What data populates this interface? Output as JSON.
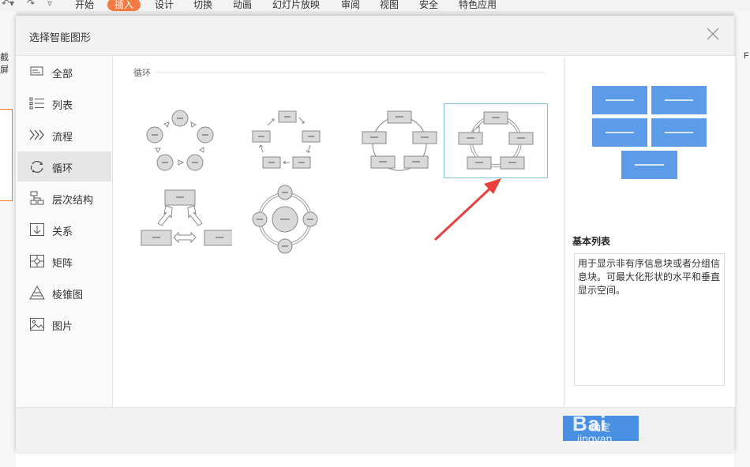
{
  "app": {
    "ribbon_tabs": [
      "开始",
      "插入",
      "设计",
      "切换",
      "动画",
      "幻灯片放映",
      "审阅",
      "视图",
      "安全",
      "特色应用"
    ],
    "active_tab": "插入",
    "left_label": "截屏",
    "right_label": "F"
  },
  "dialog": {
    "title": "选择智能图形",
    "sidebar": [
      {
        "label": "全部",
        "icon": "all-icon"
      },
      {
        "label": "列表",
        "icon": "list-icon"
      },
      {
        "label": "流程",
        "icon": "process-icon"
      },
      {
        "label": "循环",
        "icon": "cycle-icon",
        "active": true
      },
      {
        "label": "层次结构",
        "icon": "hierarchy-icon"
      },
      {
        "label": "关系",
        "icon": "relationship-icon"
      },
      {
        "label": "矩阵",
        "icon": "matrix-icon"
      },
      {
        "label": "棱锥图",
        "icon": "pyramid-icon"
      },
      {
        "label": "图片",
        "icon": "picture-icon"
      }
    ],
    "section_label": "循环",
    "options": [
      {
        "name": "basic-cycle"
      },
      {
        "name": "text-cycle"
      },
      {
        "name": "block-cycle"
      },
      {
        "name": "continuous-cycle",
        "selected": true
      },
      {
        "name": "counterbalance-arrows"
      },
      {
        "name": "radial-cycle"
      }
    ],
    "preview": {
      "name": "基本列表",
      "description": "用于显示非有序信息块或者分组信息块。可最大化形状的水平和垂直显示空间。",
      "accent": "#5b9be8"
    },
    "ok_label": "确定",
    "watermark_top": "Bai",
    "watermark_bottom": "jingyan"
  },
  "colors": {
    "accent": "#4a90e2",
    "active_tab": "#f47a42",
    "selection_border": "#7fbfe6",
    "arrow": "#e8403c"
  }
}
